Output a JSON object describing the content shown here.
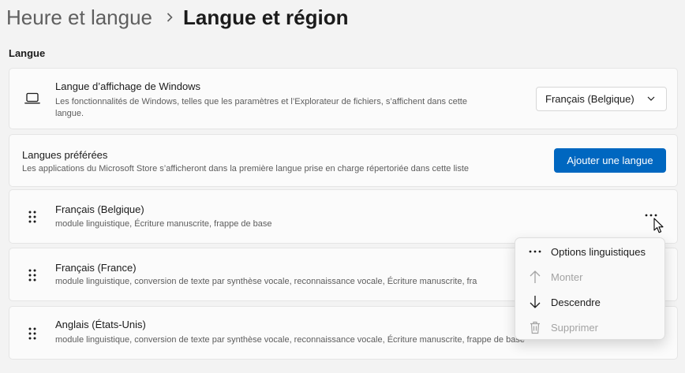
{
  "breadcrumb": {
    "parent": "Heure et langue",
    "current": "Langue et région"
  },
  "section": {
    "label": "Langue"
  },
  "display_language": {
    "title": "Langue d’affichage de Windows",
    "description_line1": "Les fonctionnalités de Windows, telles que les paramètres et l’Explorateur de fichiers, s’affichent dans cette",
    "description_line2": "langue.",
    "selected": "Français (Belgique)",
    "icon": "laptop-icon"
  },
  "preferred_languages": {
    "title": "Langues préférées",
    "description": "Les applications du Microsoft Store s’afficheront dans la première langue prise en charge répertoriée dans cette liste",
    "add_button_label": "Ajouter une langue",
    "accent": "#0067c0"
  },
  "languages": [
    {
      "name": "Français (Belgique)",
      "features": "module linguistique, Écriture manuscrite, frappe de base"
    },
    {
      "name": "Français (France)",
      "features": "module linguistique, conversion de texte par synthèse vocale, reconnaissance vocale, Écriture manuscrite, fra"
    },
    {
      "name": "Anglais (États-Unis)",
      "features": "module linguistique, conversion de texte par synthèse vocale, reconnaissance vocale, Écriture manuscrite, frappe de base"
    }
  ],
  "context_menu": {
    "items": [
      {
        "label": "Options linguistiques",
        "icon": "more-icon",
        "enabled": true
      },
      {
        "label": "Monter",
        "icon": "arrow-up-icon",
        "enabled": false
      },
      {
        "label": "Descendre",
        "icon": "arrow-down-icon",
        "enabled": true
      },
      {
        "label": "Supprimer",
        "icon": "trash-icon",
        "enabled": false
      }
    ]
  }
}
